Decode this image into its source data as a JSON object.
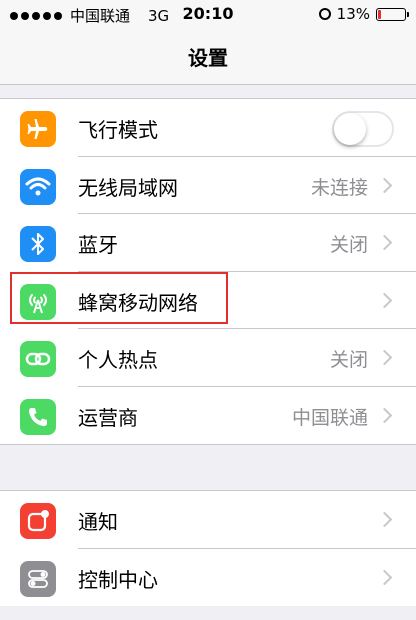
{
  "status_bar": {
    "carrier": "中国联通",
    "network": "3G",
    "time": "20:10",
    "battery": "13%",
    "battery_level": 0.13
  },
  "nav": {
    "title": "设置"
  },
  "group1": [
    {
      "label": "飞行模式",
      "value": "",
      "icon": "airplane-icon",
      "color": "#ff9500",
      "toggle": true,
      "toggle_on": false
    },
    {
      "label": "无线局域网",
      "value": "未连接",
      "icon": "wifi-icon",
      "color": "#1f8ef5"
    },
    {
      "label": "蓝牙",
      "value": "关闭",
      "icon": "bluetooth-icon",
      "color": "#1f8ef5"
    },
    {
      "label": "蜂窝移动网络",
      "value": "",
      "icon": "cellular-icon",
      "color": "#4cd964"
    },
    {
      "label": "个人热点",
      "value": "关闭",
      "icon": "hotspot-icon",
      "color": "#4cd964"
    },
    {
      "label": "运营商",
      "value": "中国联通",
      "icon": "phone-icon",
      "color": "#4cd964"
    }
  ],
  "group2": [
    {
      "label": "通知",
      "icon": "notifications-icon",
      "color": "#f43f33"
    },
    {
      "label": "控制中心",
      "icon": "control-center-icon",
      "color": "#8e8e93"
    }
  ],
  "highlight_color": "#e0302e"
}
